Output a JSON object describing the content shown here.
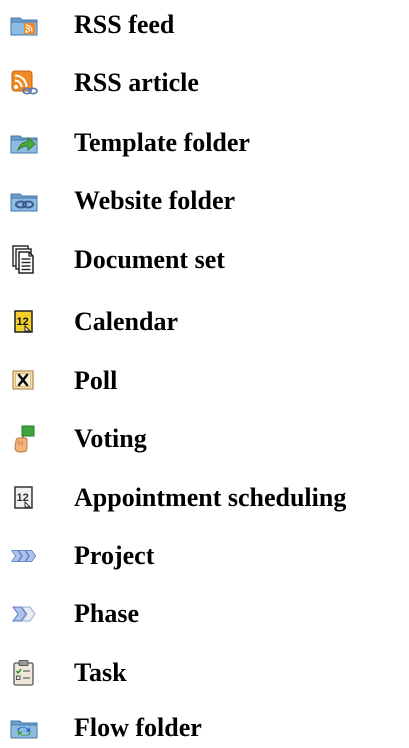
{
  "legend": {
    "items": [
      {
        "label": "RSS feed",
        "icon": "rss-feed-folder-icon"
      },
      {
        "label": "RSS article",
        "icon": "rss-article-icon"
      },
      {
        "label": "Template folder",
        "icon": "template-folder-icon"
      },
      {
        "label": "Website folder",
        "icon": "website-folder-icon"
      },
      {
        "label": "Document set",
        "icon": "document-set-icon"
      },
      {
        "label": "Calendar",
        "icon": "calendar-icon"
      },
      {
        "label": "Poll",
        "icon": "poll-icon"
      },
      {
        "label": "Voting",
        "icon": "voting-icon"
      },
      {
        "label": "Appointment scheduling",
        "icon": "appointment-scheduling-icon"
      },
      {
        "label": "Project",
        "icon": "project-icon"
      },
      {
        "label": "Phase",
        "icon": "phase-icon"
      },
      {
        "label": "Task",
        "icon": "task-icon"
      },
      {
        "label": "Flow folder",
        "icon": "flow-folder-icon"
      }
    ]
  }
}
